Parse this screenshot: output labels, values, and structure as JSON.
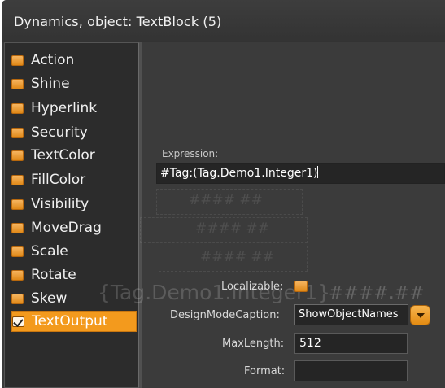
{
  "window": {
    "title": "Dynamics, object: TextBlock (5)"
  },
  "sidebar": {
    "items": [
      {
        "label": "Action",
        "checked": false
      },
      {
        "label": "Shine",
        "checked": false
      },
      {
        "label": "Hyperlink",
        "checked": false
      },
      {
        "label": "Security",
        "checked": false
      },
      {
        "label": "TextColor",
        "checked": false
      },
      {
        "label": "FillColor",
        "checked": false
      },
      {
        "label": "Visibility",
        "checked": false
      },
      {
        "label": "MoveDrag",
        "checked": false
      },
      {
        "label": "Scale",
        "checked": false
      },
      {
        "label": "Rotate",
        "checked": false
      },
      {
        "label": "Skew",
        "checked": false
      },
      {
        "label": "TextOutput",
        "checked": true,
        "selected": true
      }
    ]
  },
  "main": {
    "expression_label": "Expression:",
    "expression_value": "#Tag:(Tag.Demo1.Integer1)",
    "localizable_label": "Localizable:",
    "localizable_checked": false,
    "designmode_label": "DesignModeCaption:",
    "designmode_value": "ShowObjectNames",
    "maxlength_label": "MaxLength:",
    "maxlength_value": "512",
    "format_label": "Format:",
    "format_value": ""
  },
  "background_preview": {
    "ghost_text_large": "{Tag.Demo1.Integer1}",
    "ghost_hash": "####.##",
    "ghost_hash_small": "#### ##"
  },
  "colors": {
    "accent": "#f39a1d",
    "panel_bg": "#3b3b3b",
    "sidebar_bg": "#2c2c2c",
    "field_bg": "#252525"
  }
}
